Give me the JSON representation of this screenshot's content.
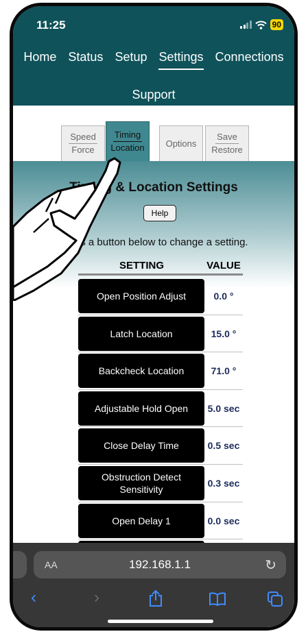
{
  "status": {
    "time": "11:25",
    "battery": "90"
  },
  "nav": {
    "row1": [
      "Home",
      "Status",
      "Setup",
      "Settings",
      "Connections"
    ],
    "row2": [
      "Support"
    ],
    "active": "Settings"
  },
  "tabs": [
    {
      "line1": "Speed",
      "line2": "Force"
    },
    {
      "line1": "Timing",
      "line2": "Location"
    },
    {
      "line1": "Options",
      "line2": ""
    },
    {
      "line1": "Save",
      "line2": "Restore"
    }
  ],
  "page": {
    "title": "Timing & Location Settings",
    "help": "Help",
    "instruction": "Press a button below to change a setting.",
    "header_setting": "SETTING",
    "header_value": "VALUE"
  },
  "settings": [
    {
      "label": "Open Position Adjust",
      "value": "0.0 °"
    },
    {
      "label": "Latch Location",
      "value": "15.0 °"
    },
    {
      "label": "Backcheck Location",
      "value": "71.0 °"
    },
    {
      "label": "Adjustable Hold Open",
      "value": "5.0 sec"
    },
    {
      "label": "Close Delay Time",
      "value": "0.5 sec"
    },
    {
      "label": "Obstruction Detect Sensitivity",
      "value": "0.3 sec"
    },
    {
      "label": "Open Delay 1",
      "value": "0.0 sec"
    }
  ],
  "browser": {
    "aa": "AA",
    "url": "192.168.1.1"
  },
  "icons": [
    "signal-icon",
    "wifi-icon",
    "reload-icon",
    "back-icon",
    "forward-icon",
    "share-icon",
    "bookmarks-icon",
    "tabs-icon",
    "pointing-hand-icon"
  ]
}
